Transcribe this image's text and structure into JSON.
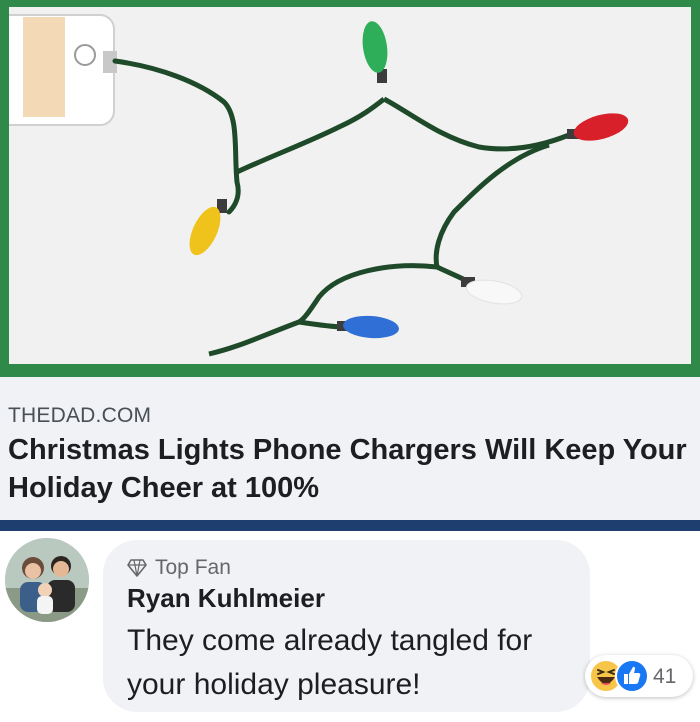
{
  "link_preview": {
    "domain": "THEDAD.COM",
    "headline": "Christmas Lights Phone Chargers Will Keep Your Holiday Cheer at 100%",
    "image": {
      "frame_color": "#2f8a4a",
      "background_color": "#f1f1f1",
      "cord_color": "#1f4a2a",
      "bulb_colors": [
        "#2fae5a",
        "#d8202a",
        "#f0c21c",
        "#f4f4f4",
        "#2f6fd6"
      ]
    }
  },
  "separator_color": "#1d3e6e",
  "comment": {
    "badge": "Top Fan",
    "author": "Ryan Kuhlmeier",
    "text": "They come already tangled for your holiday pleasure!",
    "reactions": {
      "types": [
        "haha-icon",
        "like-icon"
      ],
      "count": "41"
    }
  }
}
